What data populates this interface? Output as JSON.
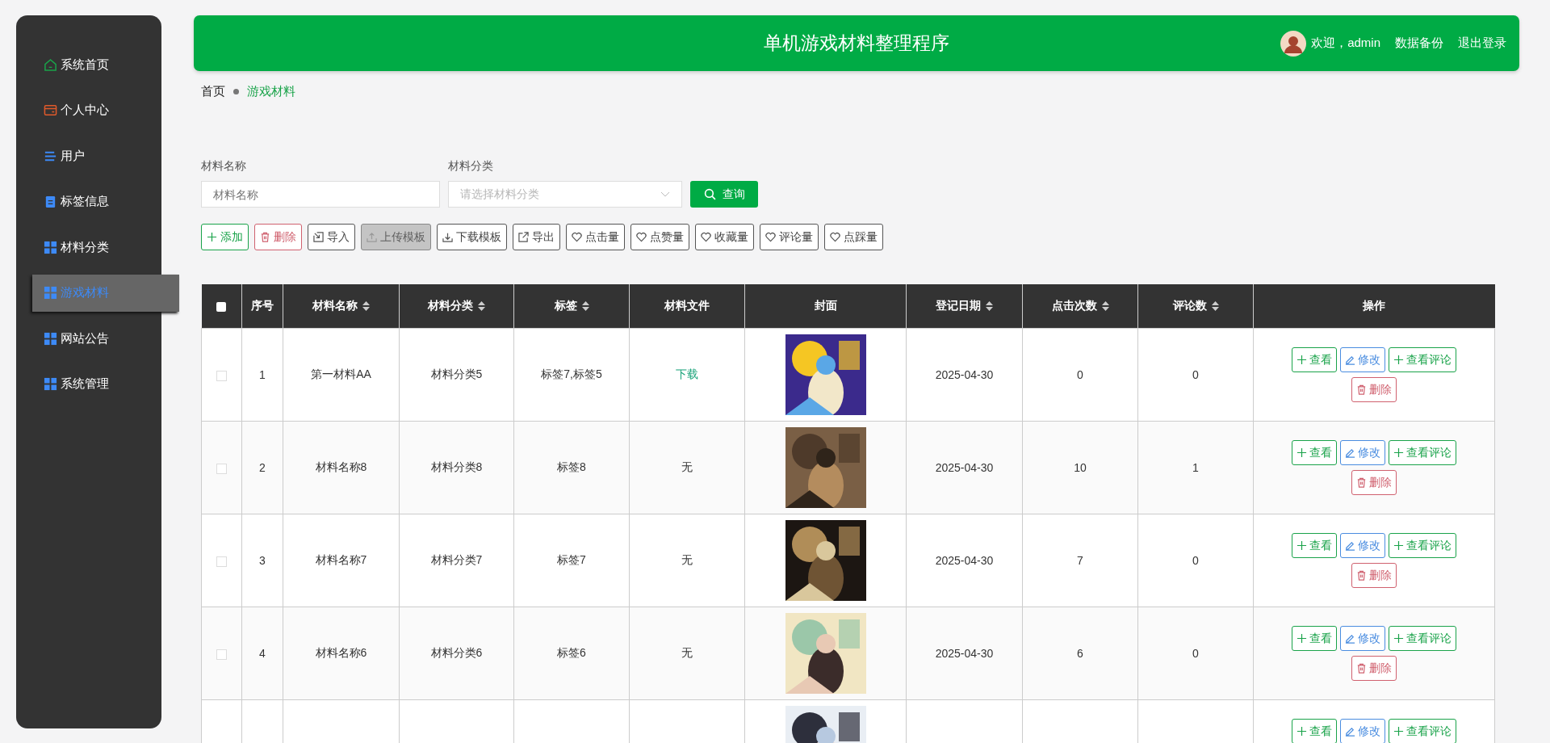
{
  "sidebar": {
    "items": [
      {
        "label": "系统首页",
        "selected": false
      },
      {
        "label": "个人中心",
        "selected": false
      },
      {
        "label": "用户",
        "selected": false
      },
      {
        "label": "标签信息",
        "selected": false
      },
      {
        "label": "材料分类",
        "selected": false
      },
      {
        "label": "游戏材料",
        "selected": true
      },
      {
        "label": "网站公告",
        "selected": false
      },
      {
        "label": "系统管理",
        "selected": false
      }
    ]
  },
  "header": {
    "title": "单机游戏材料整理程序",
    "welcome": "欢迎，admin",
    "links": [
      "数据备份",
      "退出登录"
    ]
  },
  "breadcrumb": [
    {
      "label": "首页",
      "current": false
    },
    {
      "label": "游戏材料",
      "current": true
    }
  ],
  "filters": [
    {
      "label": "材料名称",
      "kind": "input",
      "placeholder": "材料名称"
    },
    {
      "label": "材料分类",
      "kind": "select",
      "placeholder": "请选择材料分类"
    }
  ],
  "search_button": "查询",
  "toolbar": [
    {
      "label": "添加",
      "kind": "add",
      "disabled": false
    },
    {
      "label": "删除",
      "kind": "delete",
      "disabled": false
    },
    {
      "label": "导入",
      "kind": "import",
      "disabled": false
    },
    {
      "label": "上传模板",
      "kind": "upload",
      "disabled": true
    },
    {
      "label": "下载模板",
      "kind": "download",
      "disabled": false
    },
    {
      "label": "导出",
      "kind": "export",
      "disabled": false
    },
    {
      "label": "点击量",
      "kind": "heart",
      "disabled": false
    },
    {
      "label": "点赞量",
      "kind": "heart",
      "disabled": false
    },
    {
      "label": "收藏量",
      "kind": "heart",
      "disabled": false
    },
    {
      "label": "评论量",
      "kind": "heart",
      "disabled": false
    },
    {
      "label": "点踩量",
      "kind": "heart",
      "disabled": false
    }
  ],
  "table": {
    "select_all_checked": false,
    "columns": [
      {
        "label": "序号",
        "sortable": false
      },
      {
        "label": "材料名称",
        "sortable": true
      },
      {
        "label": "材料分类",
        "sortable": true
      },
      {
        "label": "标签",
        "sortable": true
      },
      {
        "label": "材料文件",
        "sortable": false
      },
      {
        "label": "封面",
        "sortable": false
      },
      {
        "label": "登记日期",
        "sortable": true
      },
      {
        "label": "点击次数",
        "sortable": true
      },
      {
        "label": "评论数",
        "sortable": true
      },
      {
        "label": "操作",
        "sortable": false
      }
    ],
    "rows": [
      {
        "checked": false,
        "index": "1",
        "name": "第一材料AA",
        "category": "材料分类5",
        "tags": "标签7,标签5",
        "file": {
          "text": "下载",
          "kind": "link"
        },
        "date": "2025-04-30",
        "clicks": "0",
        "comments": "0",
        "actions": [
          {
            "label": "查看",
            "kind": "view"
          },
          {
            "label": "修改",
            "kind": "edit"
          },
          {
            "label": "查看评论",
            "kind": "view"
          },
          {
            "label": "删除",
            "kind": "delete"
          }
        ]
      },
      {
        "checked": false,
        "index": "2",
        "name": "材料名称8",
        "category": "材料分类8",
        "tags": "标签8",
        "file": {
          "text": "无",
          "kind": "none"
        },
        "date": "2025-04-30",
        "clicks": "10",
        "comments": "1",
        "actions": [
          {
            "label": "查看",
            "kind": "view"
          },
          {
            "label": "修改",
            "kind": "edit"
          },
          {
            "label": "查看评论",
            "kind": "view"
          },
          {
            "label": "删除",
            "kind": "delete"
          }
        ]
      },
      {
        "checked": false,
        "index": "3",
        "name": "材料名称7",
        "category": "材料分类7",
        "tags": "标签7",
        "file": {
          "text": "无",
          "kind": "none"
        },
        "date": "2025-04-30",
        "clicks": "7",
        "comments": "0",
        "actions": [
          {
            "label": "查看",
            "kind": "view"
          },
          {
            "label": "修改",
            "kind": "edit"
          },
          {
            "label": "查看评论",
            "kind": "view"
          },
          {
            "label": "删除",
            "kind": "delete"
          }
        ]
      },
      {
        "checked": false,
        "index": "4",
        "name": "材料名称6",
        "category": "材料分类6",
        "tags": "标签6",
        "file": {
          "text": "无",
          "kind": "none"
        },
        "date": "2025-04-30",
        "clicks": "6",
        "comments": "0",
        "actions": [
          {
            "label": "查看",
            "kind": "view"
          },
          {
            "label": "修改",
            "kind": "edit"
          },
          {
            "label": "查看评论",
            "kind": "view"
          },
          {
            "label": "删除",
            "kind": "delete"
          }
        ]
      },
      {
        "actions": [
          {
            "label": "查看",
            "kind": "view"
          },
          {
            "label": "修改",
            "kind": "edit"
          },
          {
            "label": "查看评论",
            "kind": "view"
          }
        ]
      }
    ]
  }
}
